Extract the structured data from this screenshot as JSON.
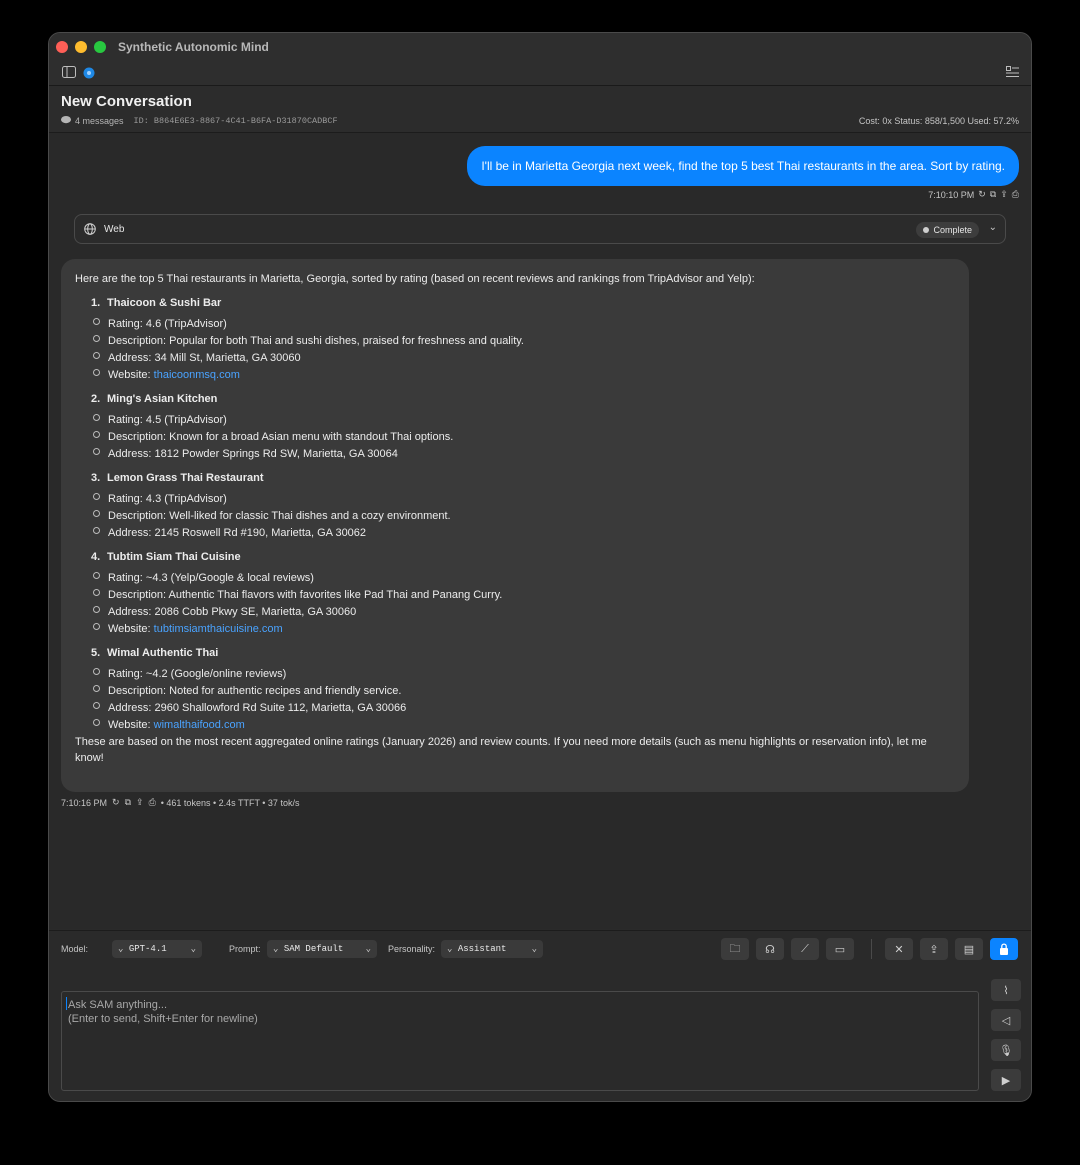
{
  "window": {
    "title": "Synthetic Autonomic Mind"
  },
  "header": {
    "title": "New Conversation",
    "message_count": "4 messages",
    "conversation_id": "ID: B864E6E3-8867-4C41-B6FA-D31870CADBCF",
    "stats": "Cost: 0x  Status: 858/1,500  Used: 57.2%"
  },
  "user_message": {
    "text": "I'll be in Marietta Georgia next week, find the top 5 best Thai restaurants in the area.  Sort by rating.",
    "time": "7:10:10 PM"
  },
  "tool_call": {
    "name": "Web",
    "status": "Complete"
  },
  "assistant_message": {
    "intro": "Here are the top 5 Thai restaurants in Marietta, Georgia, sorted by rating (based on recent reviews and rankings from TripAdvisor and Yelp):",
    "restaurants": [
      {
        "num": "1.",
        "name": "Thaicoon & Sushi Bar",
        "rating": "Rating: 4.6 (TripAdvisor)",
        "description": "Description: Popular for both Thai and sushi dishes, praised for freshness and quality.",
        "address": "Address: 34 Mill St, Marietta, GA 30060",
        "website_label": "Website: ",
        "website": "thaicoonmsq.com"
      },
      {
        "num": "2.",
        "name": "Ming's Asian Kitchen",
        "rating": "Rating: 4.5 (TripAdvisor)",
        "description": "Description: Known for a broad Asian menu with standout Thai options.",
        "address": "Address: 1812 Powder Springs Rd SW, Marietta, GA 30064"
      },
      {
        "num": "3.",
        "name": "Lemon Grass Thai Restaurant",
        "rating": "Rating: 4.3 (TripAdvisor)",
        "description": "Description: Well-liked for classic Thai dishes and a cozy environment.",
        "address": "Address: 2145 Roswell Rd #190, Marietta, GA 30062"
      },
      {
        "num": "4.",
        "name": "Tubtim Siam Thai Cuisine",
        "rating": "Rating: ~4.3 (Yelp/Google & local reviews)",
        "description": "Description: Authentic Thai flavors with favorites like Pad Thai and Panang Curry.",
        "address": "Address: 2086 Cobb Pkwy SE, Marietta, GA 30060",
        "website_label": "Website: ",
        "website": "tubtimsiamthaicuisine.com"
      },
      {
        "num": "5.",
        "name": "Wimal Authentic Thai",
        "rating": "Rating: ~4.2 (Google/online reviews)",
        "description": "Description: Noted for authentic recipes and friendly service.",
        "address": "Address: 2960 Shallowford Rd Suite 112, Marietta, GA 30066",
        "website_label": "Website: ",
        "website": "wimalthaifood.com"
      }
    ],
    "closing": "These are based on the most recent aggregated online ratings (January 2026) and review counts. If you need more details (such as menu highlights or reservation info), let me know!",
    "time": "7:10:16 PM",
    "stats": "• 461 tokens • 2.4s TTFT • 37 tok/s"
  },
  "controls": {
    "model_label": "Model:",
    "model_value": "GPT-4.1",
    "prompt_label": "Prompt:",
    "prompt_value": "SAM Default",
    "personality_label": "Personality:",
    "personality_value": "Assistant"
  },
  "composer": {
    "placeholder_line1": "Ask SAM anything...",
    "placeholder_line2": "(Enter to send, Shift+Enter for newline)"
  },
  "colors": {
    "accent": "#0b84ff",
    "link": "#4aa3ff",
    "bubble_bg": "#3a3a3a"
  },
  "icons": [
    "sidebar-toggle-icon",
    "status-dot-icon",
    "inspector-icon",
    "chat-bubble-icon",
    "regenerate-icon",
    "copy-icon",
    "share-icon",
    "print-icon",
    "globe-icon",
    "chevron-down-icon",
    "folder-icon",
    "brain-icon",
    "chart-icon",
    "terminal-icon",
    "tools-icon",
    "export-icon",
    "clipboard-icon",
    "lock-icon",
    "paperclip-icon",
    "speaker-icon",
    "microphone-icon",
    "send-icon"
  ]
}
